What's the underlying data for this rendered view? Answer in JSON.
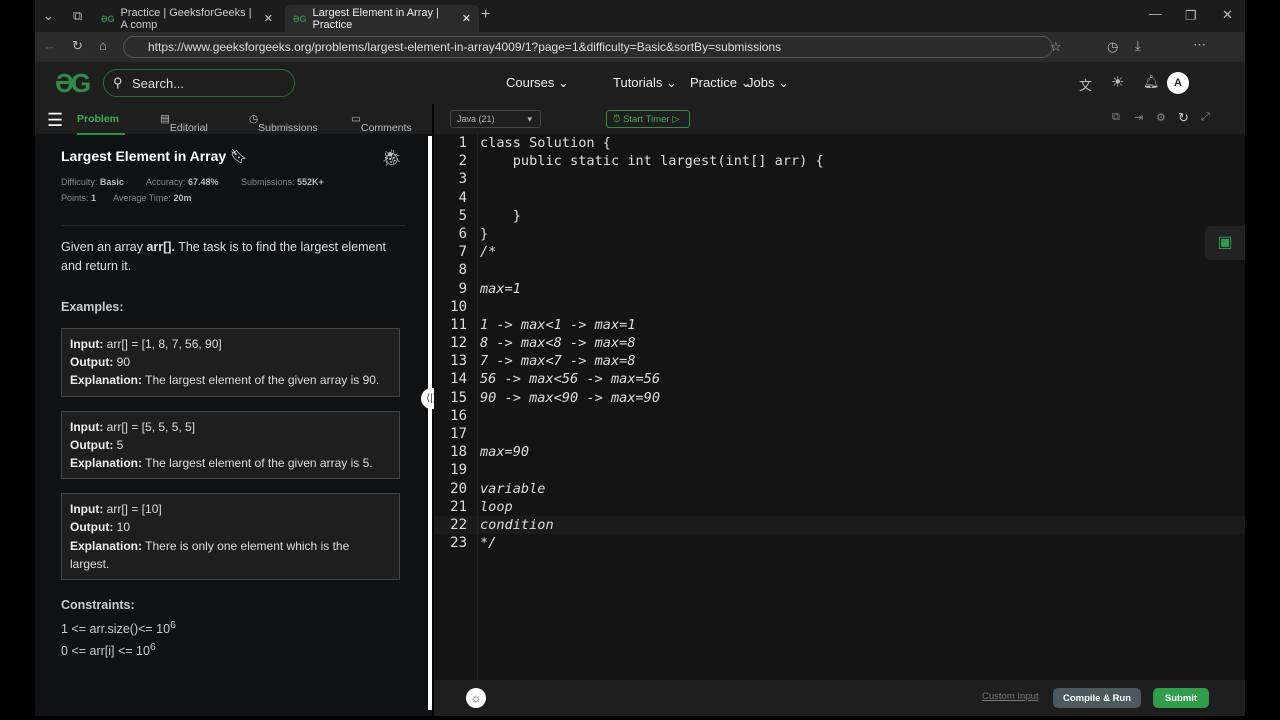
{
  "browser": {
    "tabs": [
      {
        "label": "Practice | GeeksforGeeks | A comp"
      },
      {
        "label": "Largest Element in Array | Practice"
      }
    ],
    "url": "https://www.geeksforgeeks.org/problems/largest-element-in-array4009/1?page=1&difficulty=Basic&sortBy=submissions",
    "favicon": "ƏG"
  },
  "nav": {
    "logo": "ƏG",
    "search_placeholder": "Search...",
    "menus": [
      "Courses",
      "Tutorials",
      "Practice",
      "Jobs"
    ],
    "avatar": "A"
  },
  "left": {
    "tabs": [
      "Problem",
      "Editorial",
      "Submissions",
      "Comments"
    ],
    "title": "Largest Element in Array",
    "difficulty_label": "Difficulty:",
    "difficulty": "Basic",
    "accuracy_label": "Accuracy:",
    "accuracy": "67.48%",
    "submissions_label": "Submissions:",
    "submissions": "552K+",
    "points_label": "Points:",
    "points": "1",
    "time_label": "Average Time:",
    "time": "20m",
    "desc_pre": "Given an array ",
    "desc_bold": "arr[].",
    "desc_post": " The task is to find the largest element and return it.",
    "examples_label": "Examples:",
    "examples": [
      {
        "input": "arr[] = [1, 8, 7, 56, 90]",
        "output": "90",
        "explanation": "The largest element of the given array is 90."
      },
      {
        "input": "arr[] = [5, 5, 5, 5]",
        "output": "5",
        "explanation": "The largest element of the given array is 5."
      },
      {
        "input": "arr[] = [10]",
        "output": "10",
        "explanation": "There is only one element which is the largest."
      }
    ],
    "input_label": "Input:",
    "output_label": "Output:",
    "explanation_label": "Explanation:",
    "constraints_label": "Constraints:",
    "constraints": [
      {
        "text": "1 <= arr.size()<= 10",
        "sup": "6"
      },
      {
        "text": "0 <= arr[i] <= 10",
        "sup": "6"
      }
    ]
  },
  "editor": {
    "language": "Java (21)",
    "timer": "Start Timer",
    "code": [
      "class Solution {",
      "    public static int largest(int[] arr) {",
      "",
      "",
      "    }",
      "}",
      "/*",
      "",
      "max=1",
      "",
      "1 -> max<1 -> max=1",
      "8 -> max<8 -> max=8",
      "7 -> max<7 -> max=8",
      "56 -> max<56 -> max=56",
      "90 -> max<90 -> max=90",
      "",
      "",
      "max=90",
      "",
      "variable",
      "loop",
      "condition",
      "*/"
    ],
    "custom_input": "Custom Input",
    "compile": "Compile & Run",
    "submit": "Submit"
  },
  "colors": {
    "brand": "#2f8d46",
    "submit": "#2f9e4a",
    "compile": "#4a5a5e"
  }
}
